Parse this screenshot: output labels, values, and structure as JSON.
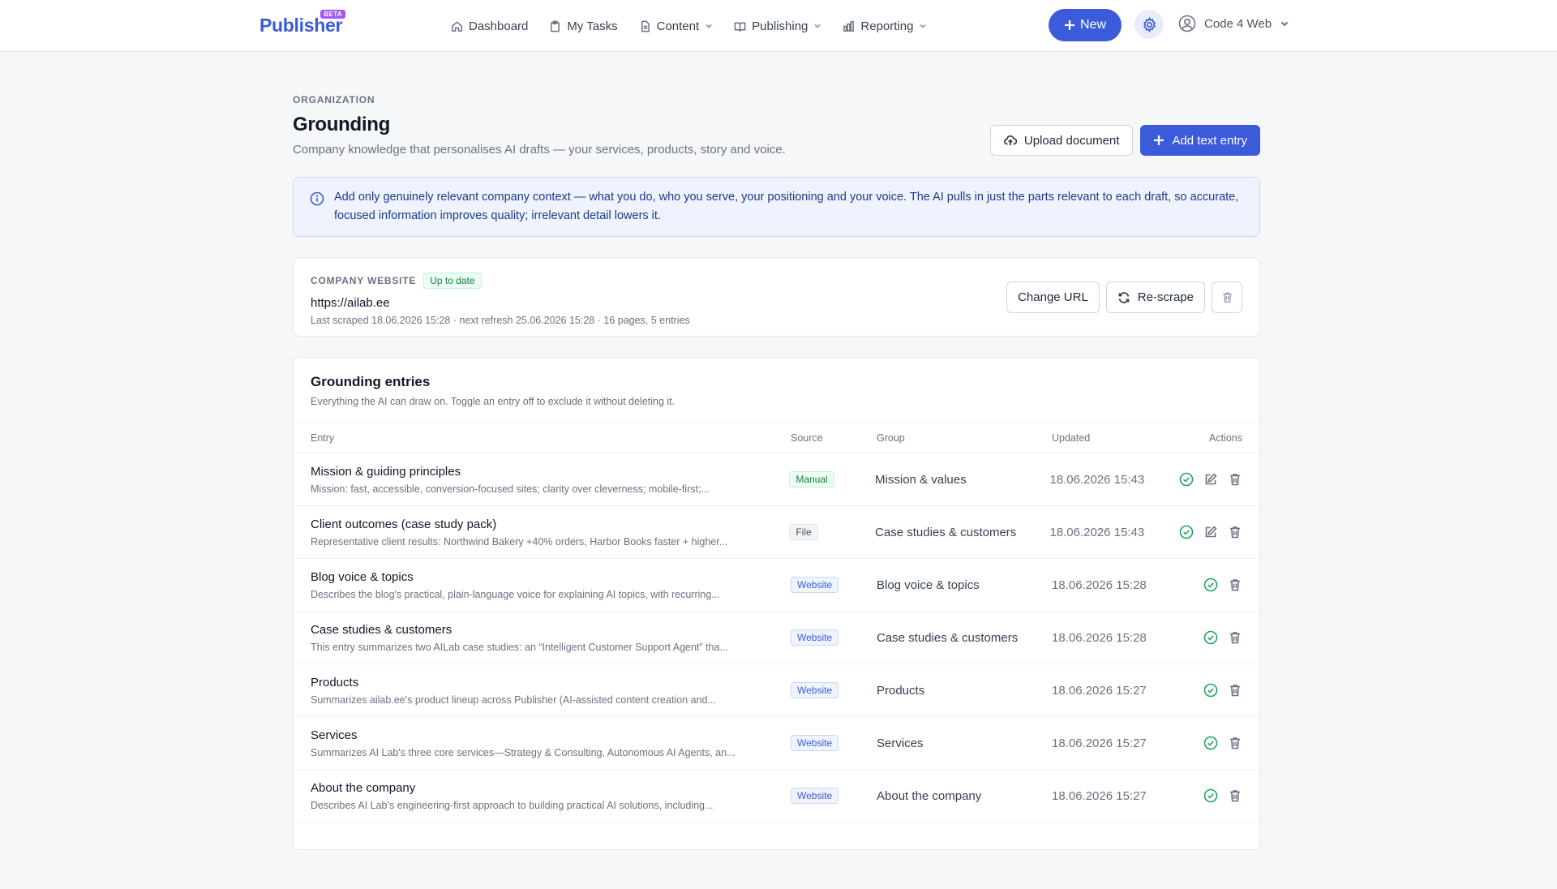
{
  "app": {
    "logo": "Publisher",
    "beta": "BETA"
  },
  "nav": {
    "items": [
      {
        "label": "Dashboard",
        "icon": "home-icon"
      },
      {
        "label": "My Tasks",
        "icon": "clipboard-icon"
      },
      {
        "label": "Content",
        "icon": "document-icon"
      },
      {
        "label": "Publishing",
        "icon": "book-icon"
      },
      {
        "label": "Reporting",
        "icon": "bar-chart-icon"
      }
    ],
    "new_label": "New",
    "account": "Code 4 Web"
  },
  "header": {
    "eyebrow": "ORGANIZATION",
    "title": "Grounding",
    "subtitle": "Company knowledge that personalises AI drafts — your services, products, story and voice.",
    "upload_label": "Upload document",
    "add_label": "Add text entry"
  },
  "info": {
    "text": "Add only genuinely relevant company context — what you do, who you serve, your positioning and your voice. The AI pulls in just the parts relevant to each draft, so accurate, focused information improves quality; irrelevant detail lowers it."
  },
  "website": {
    "label": "COMPANY WEBSITE",
    "status": "Up to date",
    "url": "https://ailab.ee",
    "meta": "Last scraped 18.06.2026 15:28 · next refresh 25.06.2026 15:28 · 16 pages, 5 entries",
    "change_label": "Change URL",
    "rescrape_label": "Re-scrape"
  },
  "entries": {
    "title": "Grounding entries",
    "subtitle": "Everything the AI can draw on. Toggle an entry off to exclude it without deleting it.",
    "columns": {
      "entry": "Entry",
      "source": "Source",
      "group": "Group",
      "updated": "Updated",
      "actions": "Actions"
    },
    "rows": [
      {
        "title": "Mission & guiding principles",
        "desc": "Mission: fast, accessible, conversion-focused sites; clarity over cleverness; mobile-first;...",
        "source": "Manual",
        "source_type": "manual",
        "group": "Mission & values",
        "updated": "18.06.2026 15:43",
        "editable": true
      },
      {
        "title": "Client outcomes (case study pack)",
        "desc": "Representative client results: Northwind Bakery +40% orders, Harbor Books faster + higher...",
        "source": "File",
        "source_type": "file",
        "group": "Case studies & customers",
        "updated": "18.06.2026 15:43",
        "editable": true
      },
      {
        "title": "Blog voice & topics",
        "desc": "Describes the blog's practical, plain-language voice for explaining AI topics, with recurring...",
        "source": "Website",
        "source_type": "website",
        "group": "Blog voice & topics",
        "updated": "18.06.2026 15:28",
        "editable": false
      },
      {
        "title": "Case studies & customers",
        "desc": "This entry summarizes two AILab case studies: an “Intelligent Customer Support Agent” tha...",
        "source": "Website",
        "source_type": "website",
        "group": "Case studies & customers",
        "updated": "18.06.2026 15:28",
        "editable": false
      },
      {
        "title": "Products",
        "desc": "Summarizes ailab.ee's product lineup across Publisher (AI-assisted content creation and...",
        "source": "Website",
        "source_type": "website",
        "group": "Products",
        "updated": "18.06.2026 15:27",
        "editable": false
      },
      {
        "title": "Services",
        "desc": "Summarizes AI Lab's three core services—Strategy & Consulting, Autonomous AI Agents, an...",
        "source": "Website",
        "source_type": "website",
        "group": "Services",
        "updated": "18.06.2026 15:27",
        "editable": false
      },
      {
        "title": "About the company",
        "desc": "Describes AI Lab's engineering-first approach to building practical AI solutions, including...",
        "source": "Website",
        "source_type": "website",
        "group": "About the company",
        "updated": "18.06.2026 15:27",
        "editable": false
      }
    ]
  },
  "colors": {
    "accent": "#3b5bdb",
    "success": "#22a35a",
    "beta": "#a855f7"
  }
}
